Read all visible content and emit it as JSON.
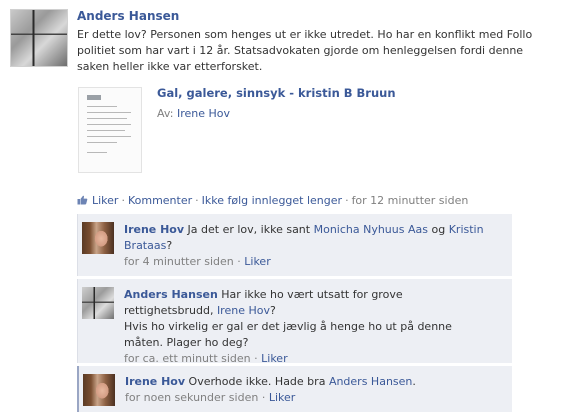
{
  "post": {
    "author": "Anders Hansen",
    "text_line1": "Er dette lov? Personen som henges ut er ikke utredet. Ho har en konflikt med Follo",
    "text_line2": "politiet som har vart i 12 år. Statsadvokaten gjorde om henleggelsen fordi denne",
    "text_line3": "saken heller ikke var etterforsket."
  },
  "attachment": {
    "title": "Gal, galere, sinnsyk - kristin B Bruun",
    "by_prefix": "Av:",
    "by_name": "Irene Hov"
  },
  "actions": {
    "like": "Liker",
    "comment": "Kommenter",
    "unfollow": "Ikke følg innlegget lenger",
    "time": "for 12 minutter siden",
    "sep": "·"
  },
  "comments": [
    {
      "author": "Irene Hov",
      "text_before": "Ja det er lov, ikke sant",
      "mention1": "Monicha Nyhuus Aas",
      "text_mid": "og",
      "mention2_a": "Kristin",
      "mention2_b": "Brataas",
      "text_after": "?",
      "time": "for 4 minutter siden",
      "like": "Liker",
      "sep": "·"
    },
    {
      "author": "Anders Hansen",
      "line1": "Har ikke ho vært utsatt for grove",
      "line2_before": "rettighetsbrudd,",
      "mention": "Irene Hov",
      "line2_after": "?",
      "line3": "Hvis ho virkelig er gal er det jævlig å henge ho ut på denne",
      "line4": "måten. Plager ho deg?",
      "time": "for ca. ett minutt siden",
      "like": "Liker",
      "sep": "·"
    },
    {
      "author": "Irene Hov",
      "text_before": "Overhode ikke. Hade bra",
      "mention": "Anders Hansen",
      "text_after": ".",
      "time": "for noen sekunder siden",
      "like": "Liker",
      "sep": "·"
    }
  ],
  "colors": {
    "link": "#3b5998",
    "comment_bg": "#edeff4",
    "muted": "#808080"
  }
}
